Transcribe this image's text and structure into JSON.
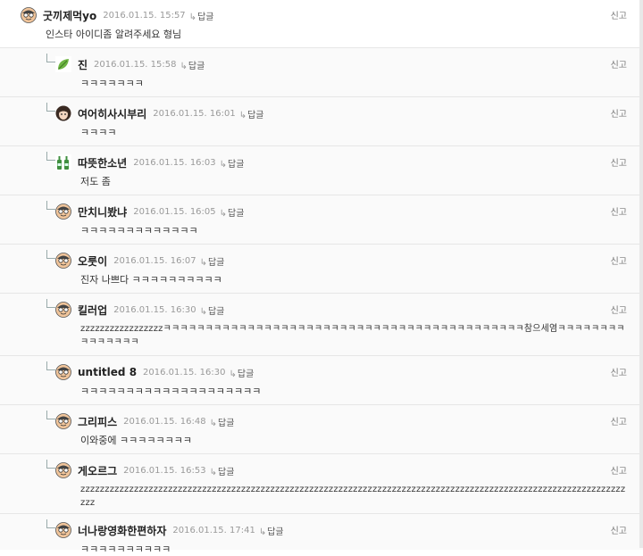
{
  "reply_label": "답글",
  "report_label": "신고",
  "comments": [
    {
      "nick": "굿끼제먹yo",
      "time": "2016.01.15. 15:57",
      "text": "인스타 아이디좀 알려주세요 형님",
      "avatar": "face"
    },
    {
      "nick": "진",
      "time": "2016.01.15. 15:58",
      "text": "ㅋㅋㅋㅋㅋㅋㅋ",
      "avatar": "leaf"
    },
    {
      "nick": "여어히사시부리",
      "time": "2016.01.15. 16:01",
      "text": "ㅋㅋㅋㅋ",
      "avatar": "girl"
    },
    {
      "nick": "따뜻한소년",
      "time": "2016.01.15. 16:03",
      "text": "저도 좀",
      "avatar": "bottles"
    },
    {
      "nick": "만치니봤냐",
      "time": "2016.01.15. 16:05",
      "text": "ㅋㅋㅋㅋㅋㅋㅋㅋㅋㅋㅋㅋㅋ",
      "avatar": "face"
    },
    {
      "nick": "오룻이",
      "time": "2016.01.15. 16:07",
      "text": "진자 나쁘다 ㅋㅋㅋㅋㅋㅋㅋㅋㅋㅋ",
      "avatar": "face"
    },
    {
      "nick": "킬러업",
      "time": "2016.01.15. 16:30",
      "text": "zzzzzzzzzzzzzzzzzㅋㅋㅋㅋㅋㅋㅋㅋㅋㅋㅋㅋㅋㅋㅋㅋㅋㅋㅋㅋㅋㅋㅋㅋㅋㅋㅋㅋㅋㅋㅋㅋㅋㅋㅋㅋㅋㅋㅋㅋㅋㅋㅋ참으세염ㅋㅋㅋㅋㅋㅋㅋㅋㅋㅋㅋㅋㅋㅋㅋ",
      "avatar": "face"
    },
    {
      "nick": "untitled 8",
      "time": "2016.01.15. 16:30",
      "text": "ㅋㅋㅋㅋㅋㅋㅋㅋㅋㅋㅋㅋㅋㅋㅋㅋㅋㅋㅋㅋ",
      "avatar": "face"
    },
    {
      "nick": "그리피스",
      "time": "2016.01.15. 16:48",
      "text": "이와중에 ㅋㅋㅋㅋㅋㅋㅋㅋ",
      "avatar": "face"
    },
    {
      "nick": "게오르그",
      "time": "2016.01.15. 16:53",
      "text": "zzzzzzzzzzzzzzzzzzzzzzzzzzzzzzzzzzzzzzzzzzzzzzzzzzzzzzzzzzzzzzzzzzzzzzzzzzzzzzzzzzzzzzzzzzzzzzzzzzzzzzzzzzzzzzzzzzz",
      "avatar": "face"
    },
    {
      "nick": "너나랑영화한편하자",
      "time": "2016.01.15. 17:41",
      "text": "ㅋㅋㅋㅋㅋㅋㅋㅋㅋㅋ",
      "avatar": "face"
    }
  ]
}
